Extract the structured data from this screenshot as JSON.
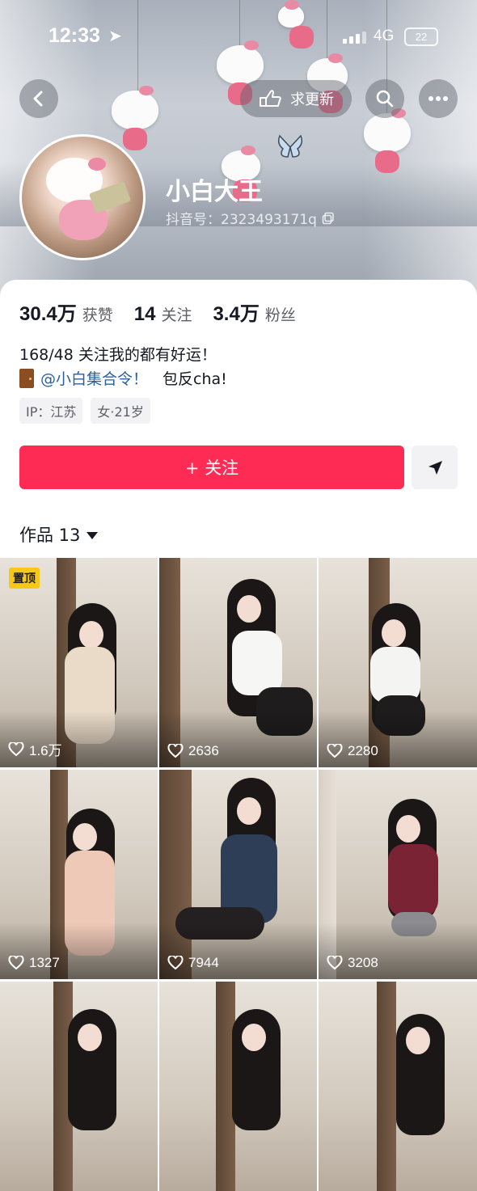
{
  "status_bar": {
    "time": "12:33",
    "network": "4G",
    "battery": "22"
  },
  "header": {
    "request_update_label": "求更新",
    "name": "小白大王",
    "douyin_id": "抖音号：2323493171q"
  },
  "stats": [
    {
      "value": "30.4万",
      "label": "获赞"
    },
    {
      "value": "14",
      "label": "关注"
    },
    {
      "value": "3.4万",
      "label": "粉丝"
    }
  ],
  "bio": {
    "line1": "168/48 关注我的都有好运！",
    "mention": "@小白集合令！",
    "line2_suffix": "包反cha!"
  },
  "tags": [
    "IP：江苏",
    "女·21岁"
  ],
  "follow_button": "+ 关注",
  "works_tab": "作品 13",
  "videos": [
    {
      "likes": "1.6万",
      "pinned": "置顶"
    },
    {
      "likes": "2636"
    },
    {
      "likes": "2280"
    },
    {
      "likes": "1327"
    },
    {
      "likes": "7944"
    },
    {
      "likes": "3208"
    },
    {
      "likes": ""
    },
    {
      "likes": ""
    },
    {
      "likes": ""
    }
  ],
  "colors": {
    "accent": "#fe2c55",
    "mention": "#2b5f9e",
    "pinned_badge": "#f6c817"
  }
}
